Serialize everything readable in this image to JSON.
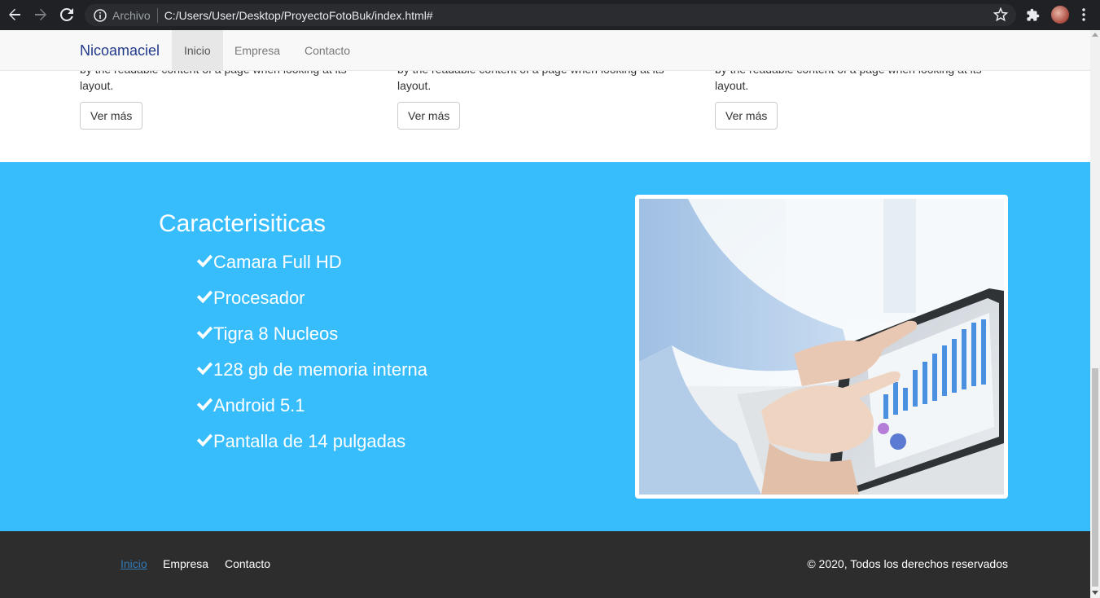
{
  "browser": {
    "archivo_label": "Archivo",
    "url": "C:/Users/User/Desktop/ProyectoFotoBuk/index.html#"
  },
  "navbar": {
    "brand": "Nicoamaciel",
    "items": [
      {
        "label": "Inicio",
        "active": true
      },
      {
        "label": "Empresa",
        "active": false
      },
      {
        "label": "Contacto",
        "active": false
      }
    ]
  },
  "cards": [
    {
      "text_line": "by the readable content of a page when looking at its",
      "text_end": "layout.",
      "button": "Ver más"
    },
    {
      "text_line": "by the readable content of a page when looking at its",
      "text_end": "layout.",
      "button": "Ver más"
    },
    {
      "text_line": "by the readable content of a page when looking at its",
      "text_end": "layout.",
      "button": "Ver más"
    }
  ],
  "features": {
    "title": "Caracterisiticas",
    "items": [
      "Camara Full HD",
      "Procesador",
      "Tigra 8 Nucleos",
      "128 gb de memoria interna",
      "Android 5.1",
      "Pantalla de 14 pulgadas"
    ],
    "bg_color": "#38bdfc"
  },
  "footer": {
    "links": [
      {
        "label": "Inicio",
        "active": true
      },
      {
        "label": "Empresa",
        "active": false
      },
      {
        "label": "Contacto",
        "active": false
      }
    ],
    "copyright": "© 2020, Todos los derechos reservados"
  }
}
